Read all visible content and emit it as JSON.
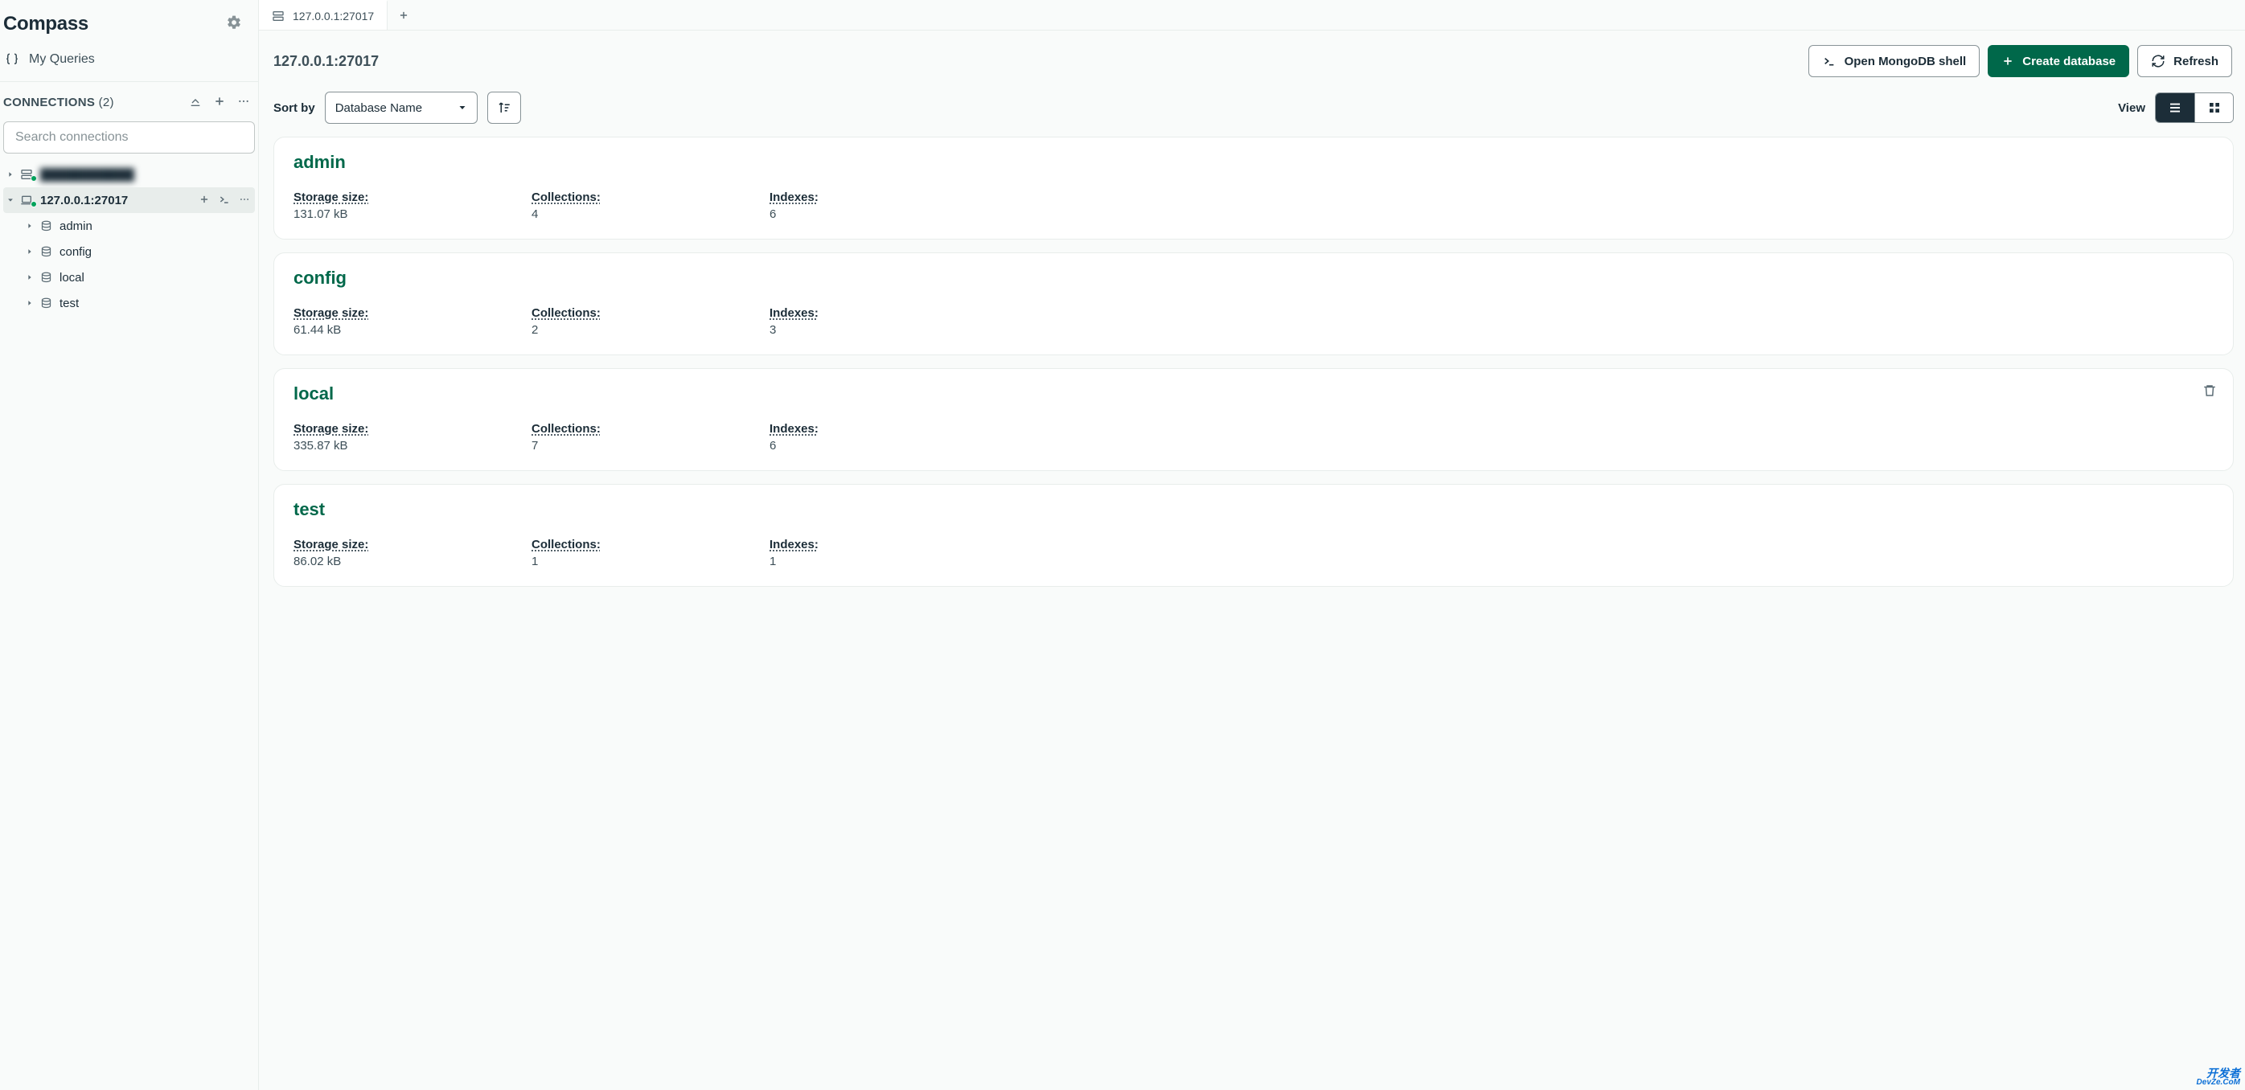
{
  "app": {
    "title": "Compass"
  },
  "sidebar": {
    "my_queries": "My Queries",
    "connections_label": "CONNECTIONS",
    "connections_count": "(2)",
    "search_placeholder": "Search connections",
    "connections": [
      {
        "label": "███████████",
        "expanded": false,
        "selected": false,
        "blurred": true
      },
      {
        "label": "127.0.0.1:27017",
        "expanded": true,
        "selected": true,
        "blurred": false
      }
    ],
    "children": [
      {
        "label": "admin"
      },
      {
        "label": "config"
      },
      {
        "label": "local"
      },
      {
        "label": "test"
      }
    ]
  },
  "tabs": {
    "active": {
      "label": "127.0.0.1:27017"
    }
  },
  "header": {
    "breadcrumb": "127.0.0.1:27017",
    "open_shell": "Open MongoDB shell",
    "create_db": "Create database",
    "refresh": "Refresh"
  },
  "toolbar": {
    "sort_by": "Sort by",
    "sort_value": "Database Name",
    "view": "View"
  },
  "labels": {
    "storage": "Storage size:",
    "collections": "Collections:",
    "indexes": "Indexes:"
  },
  "databases": [
    {
      "name": "admin",
      "storage": "131.07 kB",
      "collections": "4",
      "indexes": "6",
      "trash": false
    },
    {
      "name": "config",
      "storage": "61.44 kB",
      "collections": "2",
      "indexes": "3",
      "trash": false
    },
    {
      "name": "local",
      "storage": "335.87 kB",
      "collections": "7",
      "indexes": "6",
      "trash": true
    },
    {
      "name": "test",
      "storage": "86.02 kB",
      "collections": "1",
      "indexes": "1",
      "trash": false
    }
  ],
  "watermark": {
    "line1": "开发者",
    "line2": "DevZe.CoM"
  }
}
